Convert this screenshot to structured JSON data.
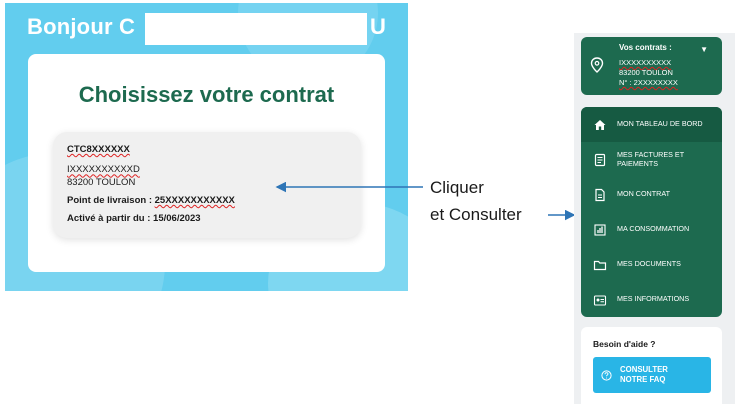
{
  "left_screen": {
    "greeting_prefix": "Bonjour C",
    "greeting_suffix": "U",
    "card_title": "Choisissez votre contrat",
    "contract": {
      "id": "CTC8XXXXXX",
      "holder": "IXXXXXXXXXXD",
      "city": "83200 TOULON",
      "point_label": "Point de livraison : ",
      "point_value": "25XXXXXXXXXXX",
      "activated": "Activé à partir du : 15/06/2023"
    }
  },
  "annotations": {
    "line1": "Cliquer",
    "line2": "et Consulter"
  },
  "sidebar": {
    "contracts_header": "Vos contrats :",
    "contract_line1": "IXXXXXXXXXX",
    "contract_city": "83200 TOULON",
    "contract_number": "N° : 2XXXXXXXX",
    "caret": "▼",
    "menu": [
      {
        "label": "MON TABLEAU DE BORD",
        "icon": "home-icon",
        "active": true
      },
      {
        "label_1": "MES FACTURES ET",
        "label_2": "PAIEMENTS",
        "icon": "invoice-icon"
      },
      {
        "label": "MON CONTRAT",
        "icon": "document-icon"
      },
      {
        "label": "MA CONSOMMATION",
        "icon": "chart-icon"
      },
      {
        "label": "MES DOCUMENTS",
        "icon": "folder-icon"
      },
      {
        "label": "MES INFORMATIONS",
        "icon": "id-card-icon"
      }
    ],
    "help_title": "Besoin d'aide ?",
    "faq_line1": "CONSULTER",
    "faq_line2": "NOTRE FAQ"
  },
  "colors": {
    "brand_green": "#1d6a4f",
    "sky_blue": "#62cdee",
    "faq_blue": "#29b5e6",
    "arrow_blue": "#2e75b6"
  }
}
